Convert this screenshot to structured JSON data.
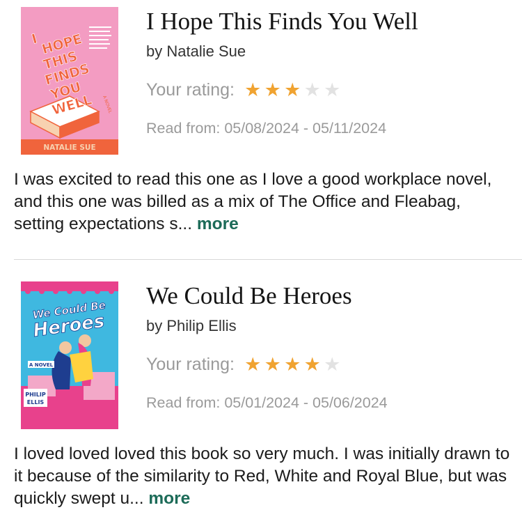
{
  "reviews": [
    {
      "title": "I Hope This Finds You Well",
      "author": "by Natalie Sue",
      "rating_label": "Your rating:",
      "rating": 3,
      "rating_max": 5,
      "read_dates": "Read from: 05/08/2024 - 05/11/2024",
      "review_text": "I was excited to read this one as I love a good workplace novel, and this one was billed as a mix of The Office and Fleabag, setting expectations s...",
      "more_label": "more",
      "cover": {
        "title_lines": [
          "HOPE",
          "THIS",
          "FINDS",
          "YOU",
          "WELL"
        ],
        "title_prefix": "I",
        "author": "NATALIE SUE",
        "subtitle": "A NOVEL",
        "bg_color": "#f39cc2",
        "accent_color": "#f0643c"
      }
    },
    {
      "title": "We Could Be Heroes",
      "author": "by Philip Ellis",
      "rating_label": "Your rating:",
      "rating": 4,
      "rating_max": 5,
      "read_dates": "Read from: 05/01/2024 - 05/06/2024",
      "review_text": "I loved loved loved this book so very much. I was initially drawn to it because of the similarity to Red, White and Royal Blue, but was quickly swept u...",
      "more_label": "more",
      "cover": {
        "title_line1": "We Could Be",
        "title_line2": "Heroes",
        "subtitle": "A NOVEL",
        "author_line1": "PHILIP",
        "author_line2": "ELLIS",
        "bg_color": "#3fb8e0",
        "accent_color": "#e8418c"
      }
    }
  ],
  "colors": {
    "star_on": "#f0a331",
    "star_off": "#e2e2e2",
    "more_link": "#1c6b58",
    "meta_text": "#9a9a9a"
  }
}
